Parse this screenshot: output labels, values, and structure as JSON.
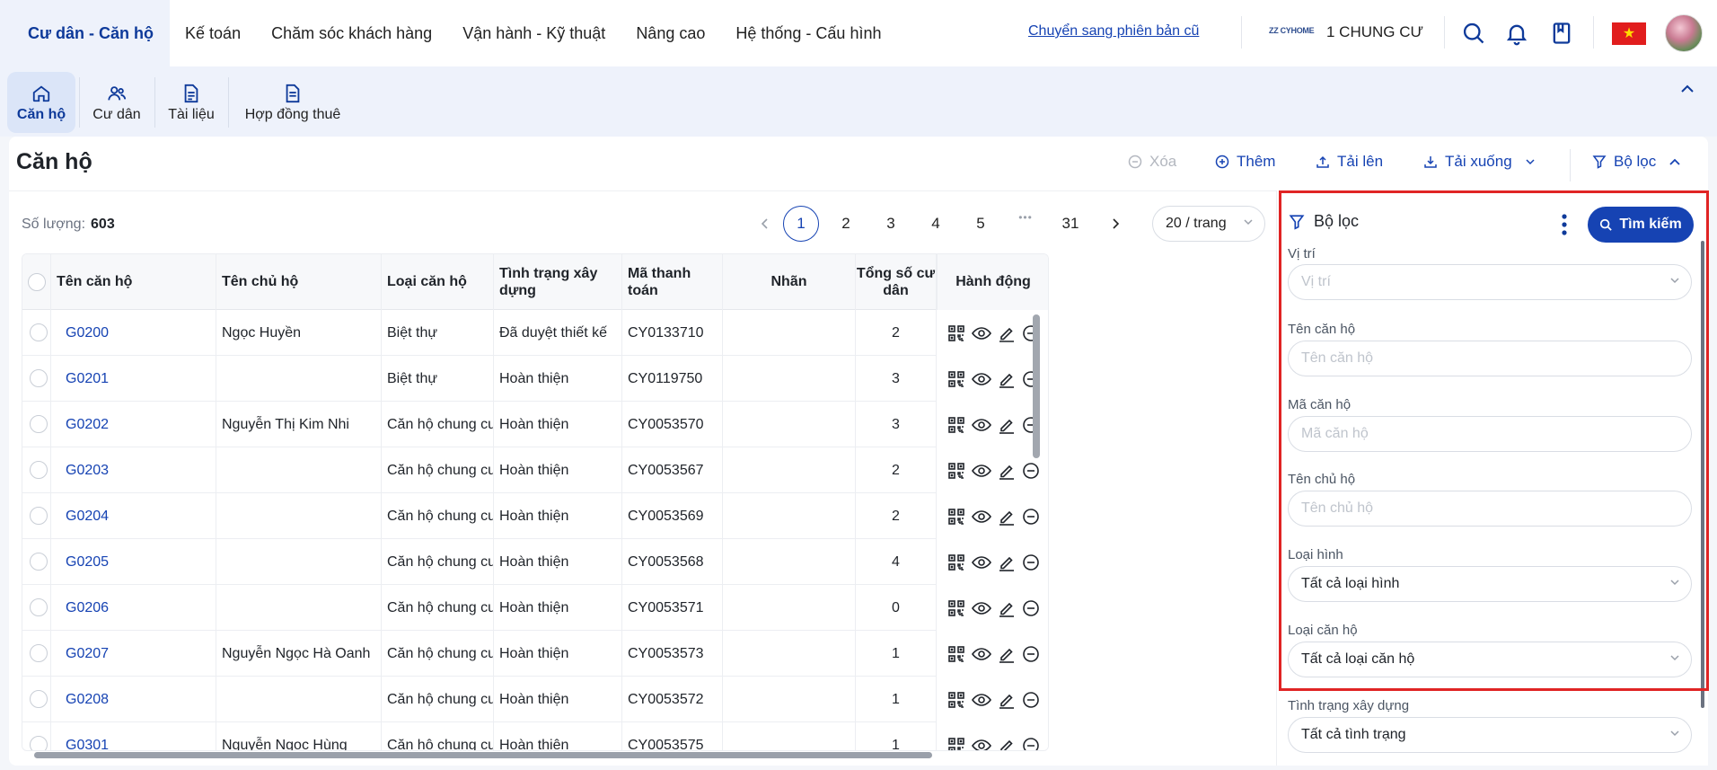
{
  "topnav": {
    "tabs": [
      "Cư dân - Căn hộ",
      "Kế toán",
      "Chăm sóc khách hàng",
      "Vận hành - Kỹ thuật",
      "Nâng cao",
      "Hệ thống - Cấu hình"
    ],
    "old_version_link": "Chuyển sang phiên bản cũ",
    "brand_logo_text": "ZZ CYHOME",
    "project_name": "1 CHUNG CƯ",
    "icons": [
      "search-icon",
      "bell-icon",
      "bookmark-icon",
      "vietnam-flag-icon",
      "avatar"
    ]
  },
  "subnav": {
    "items": [
      {
        "label": "Căn hộ",
        "icon": "home-icon",
        "active": true
      },
      {
        "label": "Cư dân",
        "icon": "users-icon",
        "active": false
      },
      {
        "label": "Tài liệu",
        "icon": "document-icon",
        "active": false
      },
      {
        "label": "Hợp đồng thuê",
        "icon": "contract-icon",
        "active": false
      }
    ]
  },
  "page": {
    "title": "Căn hộ",
    "actions": {
      "delete": "Xóa",
      "add": "Thêm",
      "upload": "Tải lên",
      "download": "Tải xuống",
      "filter": "Bộ lọc"
    },
    "count_label": "Số lượng:",
    "count_value": "603",
    "pagination": {
      "pages": [
        "1",
        "2",
        "3",
        "4",
        "5",
        "31"
      ],
      "current": "1",
      "ellipsis": "•••",
      "page_size": "20 / trang"
    }
  },
  "table": {
    "columns": [
      "Tên căn hộ",
      "Tên chủ hộ",
      "Loại căn hộ",
      "Tình trạng xây dựng",
      "Mã thanh toán",
      "Nhãn",
      "Tổng số cư dân",
      "Hành động"
    ],
    "rows": [
      {
        "code": "G0200",
        "owner": "Ngọc Huyền",
        "type": "Biệt thự",
        "status": "Đã duyệt thiết kế",
        "payment": "CY0133710",
        "tag": "",
        "residents": "2"
      },
      {
        "code": "G0201",
        "owner": "",
        "type": "Biệt thự",
        "status": "Hoàn thiện",
        "payment": "CY0119750",
        "tag": "",
        "residents": "3"
      },
      {
        "code": "G0202",
        "owner": "Nguyễn Thị Kim Nhi",
        "type": "Căn hộ chung cư",
        "status": "Hoàn thiện",
        "payment": "CY0053570",
        "tag": "",
        "residents": "3"
      },
      {
        "code": "G0203",
        "owner": "",
        "type": "Căn hộ chung cư",
        "status": "Hoàn thiện",
        "payment": "CY0053567",
        "tag": "",
        "residents": "2"
      },
      {
        "code": "G0204",
        "owner": "",
        "type": "Căn hộ chung cư",
        "status": "Hoàn thiện",
        "payment": "CY0053569",
        "tag": "",
        "residents": "2"
      },
      {
        "code": "G0205",
        "owner": "",
        "type": "Căn hộ chung cư",
        "status": "Hoàn thiện",
        "payment": "CY0053568",
        "tag": "",
        "residents": "4"
      },
      {
        "code": "G0206",
        "owner": "",
        "type": "Căn hộ chung cư",
        "status": "Hoàn thiện",
        "payment": "CY0053571",
        "tag": "",
        "residents": "0"
      },
      {
        "code": "G0207",
        "owner": "Nguyễn Ngọc Hà Oanh",
        "type": "Căn hộ chung cư",
        "status": "Hoàn thiện",
        "payment": "CY0053573",
        "tag": "",
        "residents": "1"
      },
      {
        "code": "G0208",
        "owner": "",
        "type": "Căn hộ chung cư",
        "status": "Hoàn thiện",
        "payment": "CY0053572",
        "tag": "",
        "residents": "1"
      },
      {
        "code": "G0301",
        "owner": "Nguyễn Ngọc Hùng",
        "type": "Căn hộ chung cư",
        "status": "Hoàn thiện",
        "payment": "CY0053575",
        "tag": "",
        "residents": "1"
      }
    ],
    "row_action_icons": [
      "qr-code-icon",
      "eye-icon",
      "edit-icon",
      "minus-circle-icon"
    ]
  },
  "filter_panel": {
    "title": "Bộ lọc",
    "search_button": "Tìm kiếm",
    "fields": [
      {
        "label": "Vị trí",
        "placeholder": "Vị trí",
        "value": "",
        "type": "select"
      },
      {
        "label": "Tên căn hộ",
        "placeholder": "Tên căn hộ",
        "value": "",
        "type": "text"
      },
      {
        "label": "Mã căn hộ",
        "placeholder": "Mã căn hộ",
        "value": "",
        "type": "text"
      },
      {
        "label": "Tên chủ hộ",
        "placeholder": "Tên chủ hộ",
        "value": "",
        "type": "text"
      },
      {
        "label": "Loại hình",
        "placeholder": "",
        "value": "Tất cả loại hình",
        "type": "select"
      },
      {
        "label": "Loại căn hộ",
        "placeholder": "",
        "value": "Tất cả loại căn hộ",
        "type": "select"
      },
      {
        "label": "Tình trạng xây dựng",
        "placeholder": "",
        "value": "Tất cả tình trạng",
        "type": "select"
      }
    ]
  },
  "colors": {
    "primary": "#1643b3",
    "highlight_box": "#e02424",
    "flag_red": "#e11d1d",
    "flag_star": "#ffdd00"
  }
}
